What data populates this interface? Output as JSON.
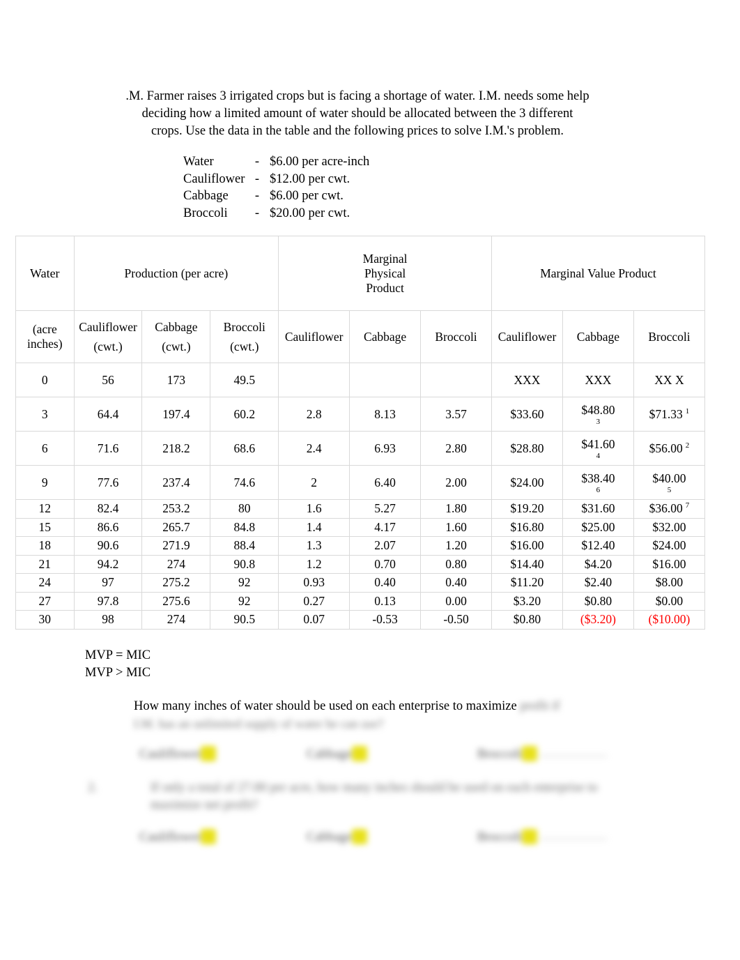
{
  "intro": {
    "line1": ".M. Farmer raises 3 irrigated crops but is facing a shortage of water.  I.M. needs some help",
    "line2": "deciding how a limited amount of water should be allocated between the 3 different",
    "line3": "crops.  Use the data in the table and the following prices to solve I.M.'s problem."
  },
  "prices": {
    "rows": [
      {
        "name": "Water",
        "dash": "-",
        "value": "$6.00 per acre-inch"
      },
      {
        "name": "Cauliflower",
        "dash": "-",
        "value": "$12.00 per cwt."
      },
      {
        "name": "Cabbage",
        "dash": "-",
        "value": "$6.00 per cwt."
      },
      {
        "name": "Broccoli",
        "dash": "-",
        "value": "$20.00 per cwt."
      }
    ]
  },
  "table": {
    "group_headers": {
      "water": "Water",
      "water_sub": "(acre inches)",
      "water_sub_l1": "(acre",
      "water_sub_l2": "inches)",
      "production": "Production (per acre)",
      "mpp_l1": "Marginal",
      "mpp_l2": "Physical",
      "mpp_l3": "Product",
      "mvp": "Marginal Value Product"
    },
    "sub_headers": {
      "prod_cauliflower": "Cauliflower",
      "prod_cauliflower_unit": "(cwt.)",
      "prod_cabbage": "Cabbage",
      "prod_cabbage_unit": "(cwt.)",
      "prod_broccoli": "Broccoli",
      "prod_broccoli_unit": "(cwt.)",
      "mpp_cauliflower": "Cauliflower",
      "mpp_cabbage": "Cabbage",
      "mpp_broccoli": "Broccoli",
      "mvp_cauliflower": "Cauliflower",
      "mvp_cabbage": "Cabbage",
      "mvp_broccoli": "Broccoli"
    },
    "rows": [
      {
        "water": "0",
        "pc": "56",
        "pcab": "173",
        "pb": "49.5",
        "mc": "",
        "mcab": "",
        "mb": "",
        "vc": "XXX",
        "vcab": "XXX",
        "vb": "XX X",
        "vcab_rank": "",
        "vb_rank": "",
        "vc_rank": ""
      },
      {
        "water": "3",
        "pc": "64.4",
        "pcab": "197.4",
        "pb": "60.2",
        "mc": "2.8",
        "mcab": "8.13",
        "mb": "3.57",
        "vc": "$33.60",
        "vcab": "$48.80",
        "vb": "$71.33",
        "vcab_rank": "3",
        "vb_rank": "1",
        "vc_rank": ""
      },
      {
        "water": "6",
        "pc": "71.6",
        "pcab": "218.2",
        "pb": "68.6",
        "mc": "2.4",
        "mcab": "6.93",
        "mb": "2.80",
        "vc": "$28.80",
        "vcab": "$41.60",
        "vb": "$56.00",
        "vcab_rank": "4",
        "vb_rank": "2",
        "vc_rank": ""
      },
      {
        "water": "9",
        "pc": "77.6",
        "pcab": "237.4",
        "pb": "74.6",
        "mc": "2",
        "mcab": "6.40",
        "mb": "2.00",
        "vc": "$24.00",
        "vcab": "$38.40",
        "vb": "$40.00",
        "vcab_rank": "6",
        "vb_rank": "5",
        "vc_rank": ""
      },
      {
        "water": "12",
        "pc": "82.4",
        "pcab": "253.2",
        "pb": "80",
        "mc": "1.6",
        "mcab": "5.27",
        "mb": "1.80",
        "vc": "$19.20",
        "vcab": "$31.60",
        "vb": "$36.00",
        "vcab_rank": "",
        "vb_rank": "7",
        "vc_rank": ""
      },
      {
        "water": "15",
        "pc": "86.6",
        "pcab": "265.7",
        "pb": "84.8",
        "mc": "1.4",
        "mcab": "4.17",
        "mb": "1.60",
        "vc": "$16.80",
        "vcab": "$25.00",
        "vb": "$32.00",
        "vcab_rank": "",
        "vb_rank": "",
        "vc_rank": ""
      },
      {
        "water": "18",
        "pc": "90.6",
        "pcab": "271.9",
        "pb": "88.4",
        "mc": "1.3",
        "mcab": "2.07",
        "mb": "1.20",
        "vc": "$16.00",
        "vcab": "$12.40",
        "vb": "$24.00",
        "vcab_rank": "",
        "vb_rank": "",
        "vc_rank": ""
      },
      {
        "water": "21",
        "pc": "94.2",
        "pcab": "274",
        "pb": "90.8",
        "mc": "1.2",
        "mcab": "0.70",
        "mb": "0.80",
        "vc": "$14.40",
        "vcab": "$4.20",
        "vb": "$16.00",
        "vcab_rank": "",
        "vb_rank": "",
        "vc_rank": ""
      },
      {
        "water": "24",
        "pc": "97",
        "pcab": "275.2",
        "pb": "92",
        "mc": "0.93",
        "mcab": "0.40",
        "mb": "0.40",
        "vc": "$11.20",
        "vcab": "$2.40",
        "vb": "$8.00",
        "vcab_rank": "",
        "vb_rank": "",
        "vc_rank": ""
      },
      {
        "water": "27",
        "pc": "97.8",
        "pcab": "275.6",
        "pb": "92",
        "mc": "0.27",
        "mcab": "0.13",
        "mb": "0.00",
        "vc": "$3.20",
        "vcab": "$0.80",
        "vb": "$0.00",
        "vcab_rank": "",
        "vb_rank": "",
        "vc_rank": ""
      },
      {
        "water": "30",
        "pc": "98",
        "pcab": "274",
        "pb": "90.5",
        "mc": "0.07",
        "mcab": "-0.53",
        "mb": "-0.50",
        "vc": "$0.80",
        "vcab": "($3.20)",
        "vb": "($10.00)",
        "vcab_rank": "",
        "vb_rank": "",
        "vc_rank": ""
      }
    ],
    "negative_color": "#ff0000",
    "border_color": "#d9d9d9"
  },
  "notes": {
    "mvp_equal": "MVP = MIC",
    "mvp_greater": "MVP > MIC"
  },
  "question1": {
    "clear_text": "How many inches of water should be used on each enterprise to maximize",
    "redacted_tail": "profit if",
    "redacted_line2": "I.M. has an unlimited supply of water he can use?",
    "answers": [
      {
        "label": "Cauliflower",
        "value": ""
      },
      {
        "label": "Cabbage",
        "value": ""
      },
      {
        "label": "Broccoli",
        "value": ""
      }
    ]
  },
  "question2": {
    "number": "2.",
    "redacted_line1": "If only a total of 27.00 per acre, how many inches should be used on each enterprise to",
    "redacted_line2": "maximize net profit?",
    "answers": [
      {
        "label": "Cauliflower",
        "value": ""
      },
      {
        "label": "Cabbage",
        "value": ""
      },
      {
        "label": "Broccoli",
        "value": ""
      }
    ]
  }
}
